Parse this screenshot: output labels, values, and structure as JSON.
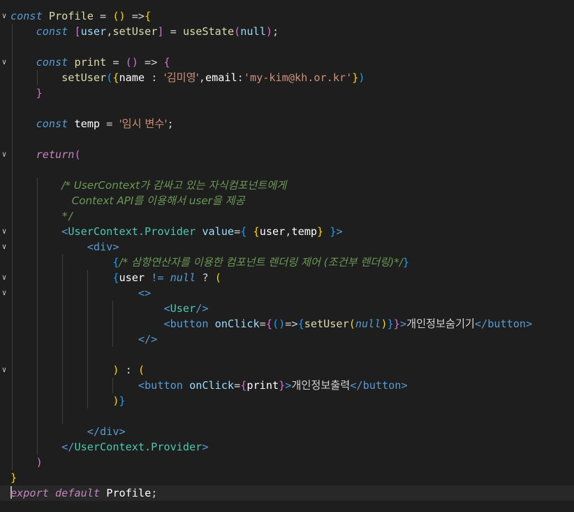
{
  "editor": {
    "language": "javascript-jsx",
    "theme_colors": {
      "background": "#1e1e1e",
      "current_line": "#282828",
      "keyword": "#569cd6",
      "control_keyword": "#c586c0",
      "function": "#dcdcaa",
      "variable": "#9cdcfe",
      "string": "#ce9178",
      "comment": "#6a9955",
      "component": "#4ec9b0",
      "bracket_level_1": "#ffd700",
      "bracket_level_2": "#da70d6",
      "bracket_level_3": "#179fff"
    },
    "cursor_line": 32,
    "lines": [
      {
        "fold": true,
        "tokens": [
          [
            "kw",
            "const"
          ],
          [
            "pl",
            " "
          ],
          [
            "fn",
            "Profile"
          ],
          [
            "pl",
            " = "
          ],
          [
            "b1",
            "()"
          ],
          [
            "pl",
            " =>"
          ],
          [
            "b1",
            "{"
          ]
        ]
      },
      {
        "fold": false,
        "tokens": [
          [
            "pl",
            "    "
          ],
          [
            "kw",
            "const"
          ],
          [
            "pl",
            " "
          ],
          [
            "b2",
            "["
          ],
          [
            "var",
            "user"
          ],
          [
            "pl",
            ","
          ],
          [
            "fn",
            "setUser"
          ],
          [
            "b2",
            "]"
          ],
          [
            "pl",
            " = "
          ],
          [
            "fn",
            "useState"
          ],
          [
            "b2",
            "("
          ],
          [
            "var",
            "null"
          ],
          [
            "b2",
            ")"
          ],
          [
            "pl",
            ";"
          ]
        ]
      },
      {
        "fold": false,
        "tokens": []
      },
      {
        "fold": true,
        "tokens": [
          [
            "pl",
            "    "
          ],
          [
            "kw",
            "const"
          ],
          [
            "pl",
            " "
          ],
          [
            "fn",
            "print"
          ],
          [
            "pl",
            " = "
          ],
          [
            "b2",
            "()"
          ],
          [
            "pl",
            " => "
          ],
          [
            "b2",
            "{"
          ]
        ]
      },
      {
        "fold": false,
        "tokens": [
          [
            "pl",
            "        "
          ],
          [
            "fn",
            "setUser"
          ],
          [
            "b3",
            "("
          ],
          [
            "b1",
            "{"
          ],
          [
            "bvar",
            "name"
          ],
          [
            "pl",
            " : "
          ],
          [
            "str",
            "'김미영'"
          ],
          [
            "pl",
            ","
          ],
          [
            "bvar",
            "email"
          ],
          [
            "pl",
            ":"
          ],
          [
            "str",
            "'my-kim@kh.or.kr'"
          ],
          [
            "b1",
            "}"
          ],
          [
            "b3",
            ")"
          ]
        ]
      },
      {
        "fold": false,
        "tokens": [
          [
            "pl",
            "    "
          ],
          [
            "b2",
            "}"
          ]
        ]
      },
      {
        "fold": false,
        "tokens": []
      },
      {
        "fold": false,
        "tokens": [
          [
            "pl",
            "    "
          ],
          [
            "kw",
            "const"
          ],
          [
            "pl",
            " "
          ],
          [
            "bvar",
            "temp"
          ],
          [
            "pl",
            " = "
          ],
          [
            "str",
            "'임시 변수'"
          ],
          [
            "pl",
            ";"
          ]
        ]
      },
      {
        "fold": false,
        "tokens": []
      },
      {
        "fold": true,
        "tokens": [
          [
            "pl",
            "    "
          ],
          [
            "kwc",
            "return"
          ],
          [
            "b2",
            "("
          ]
        ]
      },
      {
        "fold": false,
        "tokens": []
      },
      {
        "fold": false,
        "tokens": [
          [
            "pl",
            "        "
          ],
          [
            "cmt",
            "/* UserContext가 감싸고 있는 자식컴포넌트에게"
          ]
        ]
      },
      {
        "fold": false,
        "tokens": [
          [
            "pl",
            "        "
          ],
          [
            "cmt",
            "   Context API를 이용해서 user을 제공"
          ]
        ]
      },
      {
        "fold": false,
        "tokens": [
          [
            "pl",
            "        "
          ],
          [
            "cmt",
            "*/"
          ]
        ]
      },
      {
        "fold": true,
        "tokens": [
          [
            "pl",
            "        "
          ],
          [
            "tag",
            "<"
          ],
          [
            "cls",
            "UserContext.Provider"
          ],
          [
            "pl",
            " "
          ],
          [
            "attr",
            "value"
          ],
          [
            "pl",
            "="
          ],
          [
            "b3",
            "{"
          ],
          [
            "pl",
            " "
          ],
          [
            "b1",
            "{"
          ],
          [
            "bvar",
            "user"
          ],
          [
            "pl",
            ","
          ],
          [
            "bvar",
            "temp"
          ],
          [
            "b1",
            "}"
          ],
          [
            "pl",
            " "
          ],
          [
            "b3",
            "}"
          ],
          [
            "tag",
            ">"
          ]
        ]
      },
      {
        "fold": true,
        "tokens": [
          [
            "pl",
            "            "
          ],
          [
            "tag",
            "<"
          ],
          [
            "tag",
            "div"
          ],
          [
            "tag",
            ">"
          ]
        ]
      },
      {
        "fold": false,
        "tokens": [
          [
            "pl",
            "                "
          ],
          [
            "b3",
            "{"
          ],
          [
            "cmt",
            "/* 삼항연산자를 이용한 컴포넌트 렌더링 제어 (조건부 렌더링)*/"
          ],
          [
            "b3",
            "}"
          ]
        ]
      },
      {
        "fold": true,
        "tokens": [
          [
            "pl",
            "                "
          ],
          [
            "b3",
            "{"
          ],
          [
            "bvar",
            "user"
          ],
          [
            "pl",
            " "
          ],
          [
            "tag",
            "!="
          ],
          [
            "pl",
            " "
          ],
          [
            "kw",
            "null"
          ],
          [
            "pl",
            " "
          ],
          [
            "pl",
            "?"
          ],
          [
            "pl",
            " "
          ],
          [
            "b1",
            "("
          ]
        ]
      },
      {
        "fold": true,
        "tokens": [
          [
            "pl",
            "                    "
          ],
          [
            "tag",
            "<>"
          ]
        ]
      },
      {
        "fold": false,
        "tokens": [
          [
            "pl",
            "                        "
          ],
          [
            "tag",
            "<"
          ],
          [
            "cls",
            "User"
          ],
          [
            "tag",
            "/>"
          ]
        ]
      },
      {
        "fold": false,
        "tokens": [
          [
            "pl",
            "                        "
          ],
          [
            "tag",
            "<"
          ],
          [
            "tag",
            "button"
          ],
          [
            "pl",
            " "
          ],
          [
            "attr",
            "onClick"
          ],
          [
            "pl",
            "="
          ],
          [
            "b2",
            "{"
          ],
          [
            "b3",
            "()"
          ],
          [
            "pl",
            "=>"
          ],
          [
            "b3",
            "{"
          ],
          [
            "fn",
            "setUser"
          ],
          [
            "b1",
            "("
          ],
          [
            "kw",
            "null"
          ],
          [
            "b1",
            ")"
          ],
          [
            "b3",
            "}"
          ],
          [
            "b2",
            "}"
          ],
          [
            "tag",
            ">"
          ],
          [
            "pl",
            "개인정보숨기기"
          ],
          [
            "tag",
            "</"
          ],
          [
            "tag",
            "button"
          ],
          [
            "tag",
            ">"
          ]
        ]
      },
      {
        "fold": false,
        "tokens": [
          [
            "pl",
            "                    "
          ],
          [
            "tag",
            "</>"
          ]
        ]
      },
      {
        "fold": false,
        "tokens": []
      },
      {
        "fold": true,
        "tokens": [
          [
            "pl",
            "                "
          ],
          [
            "b1",
            ")"
          ],
          [
            "pl",
            " : "
          ],
          [
            "b1",
            "("
          ]
        ]
      },
      {
        "fold": false,
        "tokens": [
          [
            "pl",
            "                    "
          ],
          [
            "tag",
            "<"
          ],
          [
            "tag",
            "button"
          ],
          [
            "pl",
            " "
          ],
          [
            "attr",
            "onClick"
          ],
          [
            "pl",
            "="
          ],
          [
            "b2",
            "{"
          ],
          [
            "bvar",
            "print"
          ],
          [
            "b2",
            "}"
          ],
          [
            "tag",
            ">"
          ],
          [
            "pl",
            "개인정보출력"
          ],
          [
            "tag",
            "</"
          ],
          [
            "tag",
            "button"
          ],
          [
            "tag",
            ">"
          ]
        ]
      },
      {
        "fold": false,
        "tokens": [
          [
            "pl",
            "                "
          ],
          [
            "b1",
            ")"
          ],
          [
            "b3",
            "}"
          ]
        ]
      },
      {
        "fold": false,
        "tokens": []
      },
      {
        "fold": false,
        "tokens": [
          [
            "pl",
            "            "
          ],
          [
            "tag",
            "</"
          ],
          [
            "tag",
            "div"
          ],
          [
            "tag",
            ">"
          ]
        ]
      },
      {
        "fold": false,
        "tokens": [
          [
            "pl",
            "        "
          ],
          [
            "tag",
            "</"
          ],
          [
            "cls",
            "UserContext.Provider"
          ],
          [
            "tag",
            ">"
          ]
        ]
      },
      {
        "fold": false,
        "tokens": [
          [
            "pl",
            "    "
          ],
          [
            "b2",
            ")"
          ]
        ]
      },
      {
        "fold": false,
        "tokens": [
          [
            "b1",
            "}"
          ]
        ]
      },
      {
        "fold": false,
        "tokens": [
          [
            "kwc",
            "export"
          ],
          [
            "pl",
            " "
          ],
          [
            "kwc",
            "default"
          ],
          [
            "pl",
            " "
          ],
          [
            "bvar",
            "Profile"
          ],
          [
            "pl",
            ";"
          ]
        ]
      }
    ]
  }
}
